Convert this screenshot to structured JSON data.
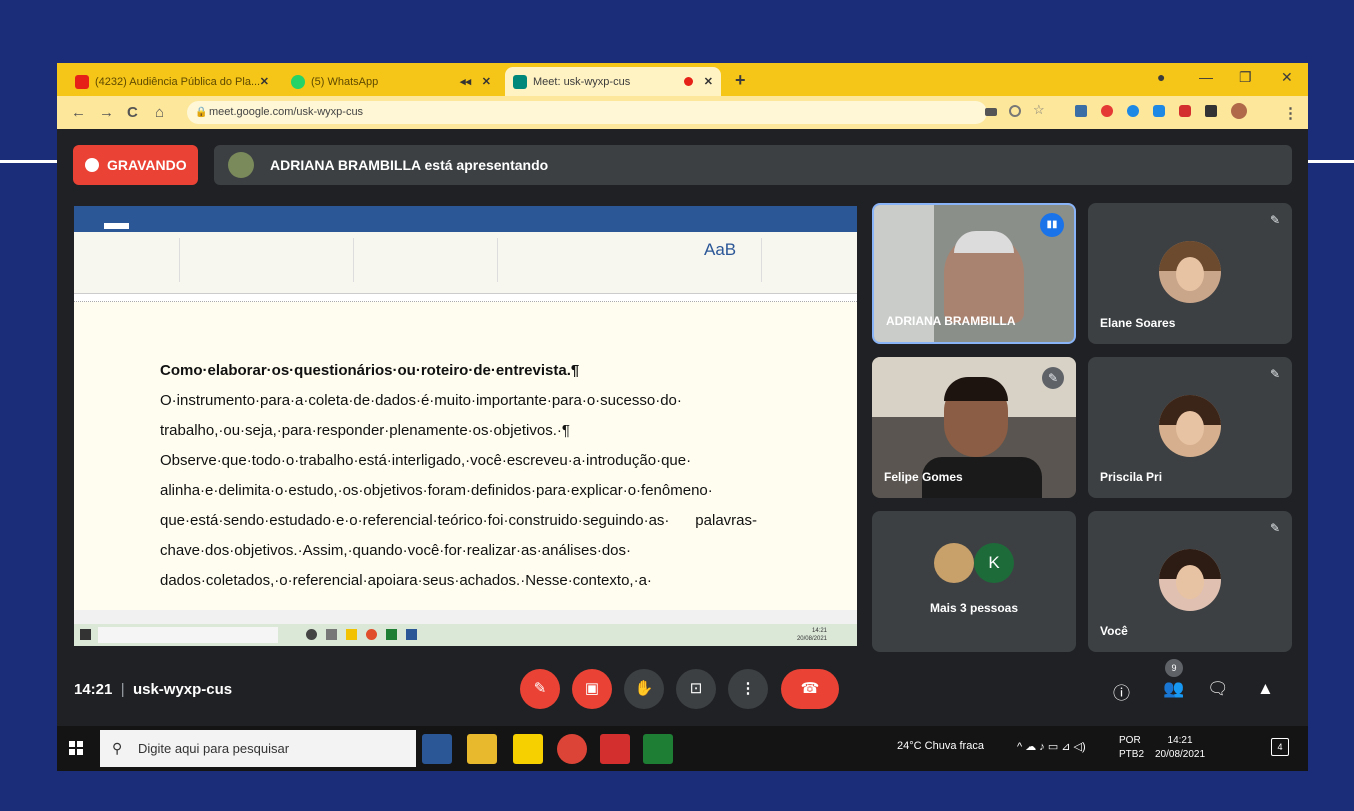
{
  "browser": {
    "tabs": [
      {
        "label": "(4232) Audiência Pública do Pla...",
        "favicon_color": "#e62117",
        "favicon": "youtube-icon"
      },
      {
        "label": "(5) WhatsApp",
        "favicon_color": "#25d366",
        "favicon": "whatsapp-icon"
      },
      {
        "label": "Meet: usk-wyxp-cus",
        "favicon_color": "#00897b",
        "favicon": "meet-icon"
      }
    ],
    "url": "meet.google.com/usk-wyxp-cus"
  },
  "meet": {
    "recording_label": "GRAVANDO",
    "presenting_text": "ADRIANA BRAMBILLA está apresentando",
    "meeting_time": "14:21",
    "meeting_code": "usk-wyxp-cus",
    "participants_badge": "9"
  },
  "word": {
    "heading": "Como·elaborar·os·questionários·ou·roteiro·de·entrevista.¶",
    "paragraph1": "O·instrumento·para·a·coleta·de·dados·é·muito·importante·para·o·sucesso·do· trabalho,·ou·seja,·para·responder·plenamente·os·objetivos.·¶",
    "paragraph2": "Observe·que·todo·o·trabalho·está·interligado,·você·escreveu·a·introdução·que· alinha·e·delimita·o·estudo,·os·objetivos·foram·definidos·para·explicar·o·fenômeno· que·está·sendo·estudado·e·o·referencial·teórico·foi·construido·seguindo·as· palavras-chave·dos·objetivos.·Assim,·quando·você·for·realizar·as·análises·dos· dados·coletados,·o·referencial·apoiara·seus·achados.·Nesse·contexto,·a·",
    "ribbon_style_label": "AaB",
    "clock_time": "14:21",
    "clock_date": "20/08/2021"
  },
  "participants": [
    {
      "name": "ADRIANA BRAMBILLA",
      "speaking": true
    },
    {
      "name": "Elane Soares",
      "muted": true
    },
    {
      "name": "Felipe Gomes",
      "muted": true
    },
    {
      "name": "Priscila Pri",
      "muted": true
    },
    {
      "name": "Mais 3 pessoas",
      "initial": "K"
    },
    {
      "name": "Você",
      "muted": true
    }
  ],
  "taskbar": {
    "search_placeholder": "Digite aqui para pesquisar",
    "weather": "24°C  Chuva fraca",
    "lang_top": "POR",
    "lang_bottom": "PTB2",
    "clock_time": "14:21",
    "clock_date": "20/08/2021",
    "notification_count": "4"
  },
  "colors": {
    "accent_red": "#ea4335",
    "meet_bg": "#202124",
    "tile_bg": "#3c4043",
    "speaking_blue": "#1a73e8"
  }
}
